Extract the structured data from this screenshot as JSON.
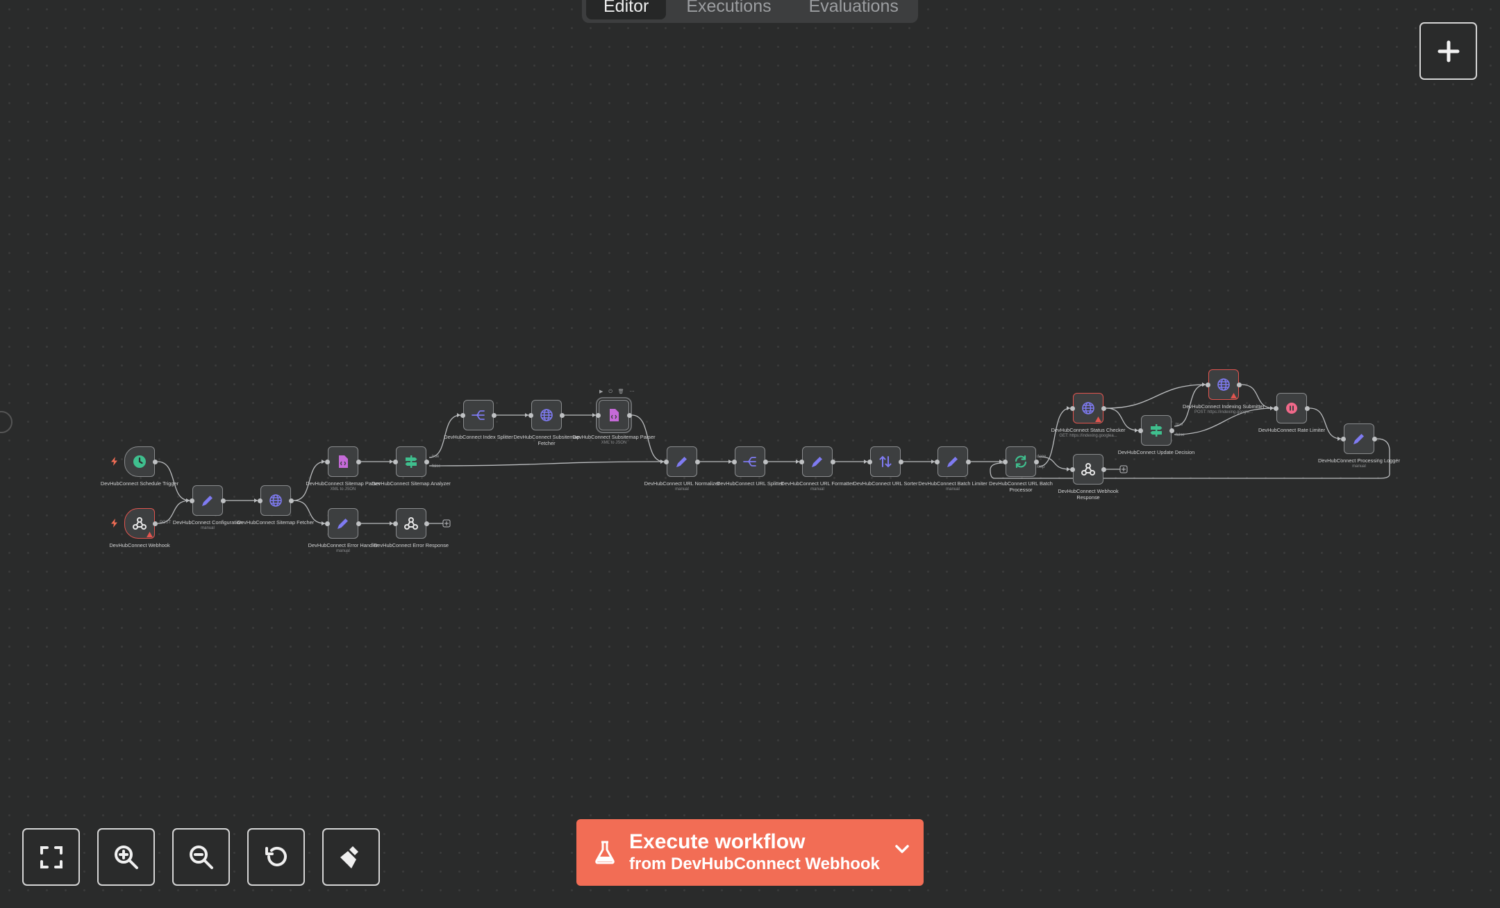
{
  "tabs": [
    {
      "label": "Editor",
      "active": true
    },
    {
      "label": "Executions",
      "active": false
    },
    {
      "label": "Evaluations",
      "active": false
    }
  ],
  "execute": {
    "title": "Execute workflow",
    "subtitle": "from DevHubConnect Webhook"
  },
  "node_toolbar": "▶ ⏻ 🗑 ⋯",
  "nodes": [
    {
      "id": "schedule",
      "label": "DevHubConnect Schedule Trigger",
      "sub": "",
      "icon": "clock-icon",
      "trigger": true,
      "warn": false
    },
    {
      "id": "webhook",
      "label": "DevHubConnect Webhook",
      "sub": "",
      "icon": "webhook-icon",
      "trigger": true,
      "warn": true
    },
    {
      "id": "config",
      "label": "DevHubConnect Configuration",
      "sub": "manual",
      "icon": "pencil-icon",
      "trigger": false,
      "warn": false
    },
    {
      "id": "sitemap_fetch",
      "label": "DevHubConnect Sitemap Fetcher",
      "sub": "",
      "icon": "globe-icon",
      "trigger": false,
      "warn": false
    },
    {
      "id": "sitemap_parse",
      "label": "DevHubConnect Sitemap Parser",
      "sub": "XML to JSON",
      "icon": "file-code-icon",
      "trigger": false,
      "warn": false
    },
    {
      "id": "error_handler",
      "label": "DevHubConnect Error Handler",
      "sub": "manual",
      "icon": "pencil-icon",
      "trigger": false,
      "warn": false
    },
    {
      "id": "sitemap_analyze",
      "label": "DevHubConnect Sitemap Analyzer",
      "sub": "",
      "icon": "switch-icon",
      "trigger": false,
      "warn": false
    },
    {
      "id": "error_response",
      "label": "DevHubConnect Error Response",
      "sub": "",
      "icon": "webhook-icon",
      "trigger": false,
      "warn": false
    },
    {
      "id": "index_split",
      "label": "DevHubConnect Index Splitter",
      "sub": "",
      "icon": "split-icon",
      "trigger": false,
      "warn": false
    },
    {
      "id": "subsitemap_fetch",
      "label": "DevHubConnect Subsitemap Fetcher",
      "sub": "",
      "icon": "globe-icon",
      "trigger": false,
      "warn": false
    },
    {
      "id": "subsitemap_parse",
      "label": "DevHubConnect Subsitemap Parser",
      "sub": "XML to JSON",
      "icon": "file-code-icon",
      "trigger": false,
      "warn": false
    },
    {
      "id": "url_norm",
      "label": "DevHubConnect URL Normalizer",
      "sub": "manual",
      "icon": "pencil-icon",
      "trigger": false,
      "warn": false
    },
    {
      "id": "url_split",
      "label": "DevHubConnect URL Splitter",
      "sub": "",
      "icon": "split-icon",
      "trigger": false,
      "warn": false
    },
    {
      "id": "url_format",
      "label": "DevHubConnect URL Formatter",
      "sub": "manual",
      "icon": "pencil-icon",
      "trigger": false,
      "warn": false
    },
    {
      "id": "url_sort",
      "label": "DevHubConnect URL Sorter",
      "sub": "",
      "icon": "sort-icon",
      "trigger": false,
      "warn": false
    },
    {
      "id": "batch_limit",
      "label": "DevHubConnect Batch Limiter",
      "sub": "manual",
      "icon": "pencil-icon",
      "trigger": false,
      "warn": false
    },
    {
      "id": "batch_proc",
      "label": "DevHubConnect URL Batch Processor",
      "sub": "",
      "icon": "loop-icon",
      "trigger": false,
      "warn": false
    },
    {
      "id": "webhook_resp",
      "label": "DevHubConnect Webhook Response",
      "sub": "",
      "icon": "webhook-icon",
      "trigger": false,
      "warn": false
    },
    {
      "id": "status_check",
      "label": "DevHubConnect Status Checker",
      "sub": "GET: https://indexing.googlea...",
      "icon": "globe-icon",
      "trigger": false,
      "warn": true
    },
    {
      "id": "update_dec",
      "label": "DevHubConnect Update Decision",
      "sub": "",
      "icon": "switch-icon",
      "trigger": false,
      "warn": false
    },
    {
      "id": "index_submit",
      "label": "DevHubConnect Indexing Submitter",
      "sub": "POST: https://indexing.google...",
      "icon": "globe-icon",
      "trigger": false,
      "warn": true
    },
    {
      "id": "rate_limit",
      "label": "DevHubConnect Rate Limiter",
      "sub": "",
      "icon": "pause-icon",
      "trigger": false,
      "warn": false
    },
    {
      "id": "proc_logger",
      "label": "DevHubConnect Processing Logger",
      "sub": "manual",
      "icon": "pencil-icon",
      "trigger": false,
      "warn": false
    }
  ],
  "edge_labels": {
    "webhook_post": "POST",
    "analyze_true": "true",
    "analyze_false": "false",
    "batch_done": "done",
    "batch_loop": "loop",
    "update_true": "true",
    "update_false": "false"
  },
  "colors": {
    "accent": "#f26d55",
    "icon_purple": "#7f7bf2",
    "icon_magenta": "#c56ad8",
    "icon_green": "#3fbf8e",
    "icon_pink": "#f0698a",
    "warn": "#e2554f"
  }
}
